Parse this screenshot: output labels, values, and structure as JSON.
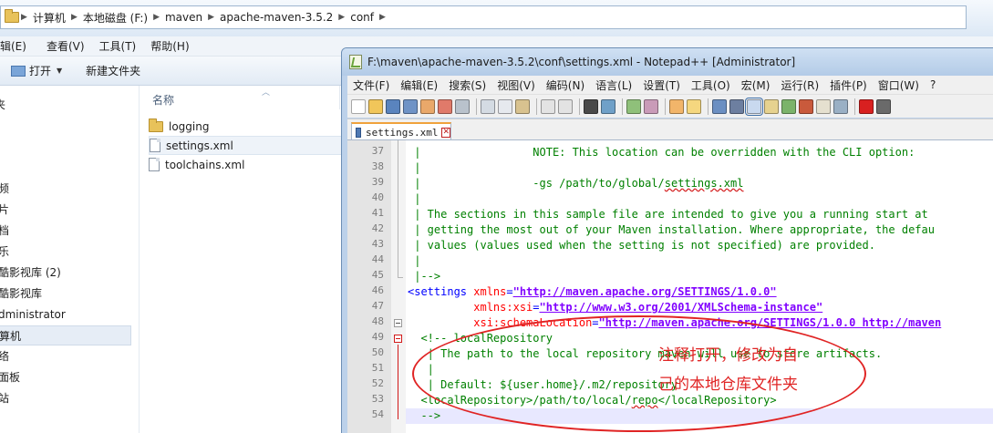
{
  "explorer": {
    "breadcrumb": [
      "计算机",
      "本地磁盘 (F:)",
      "maven",
      "apache-maven-3.5.2",
      "conf"
    ],
    "menu": [
      "编辑(E)",
      "查看(V)",
      "工具(T)",
      "帮助(H)"
    ],
    "toolbar": {
      "open": "打开",
      "new_folder": "新建文件夹"
    },
    "nav_items": [
      "夹",
      "频",
      "片",
      "档",
      "乐",
      "酷影视库 (2)",
      "酷影视库",
      "dministrator",
      "算机",
      "络",
      "面板",
      "站"
    ],
    "column_name": "名称",
    "files": [
      {
        "name": "logging",
        "type": "folder"
      },
      {
        "name": "settings.xml",
        "type": "file"
      },
      {
        "name": "toolchains.xml",
        "type": "file"
      }
    ]
  },
  "npp": {
    "title": "F:\\maven\\apache-maven-3.5.2\\conf\\settings.xml - Notepad++ [Administrator]",
    "menu": [
      "文件(F)",
      "编辑(E)",
      "搜索(S)",
      "视图(V)",
      "编码(N)",
      "语言(L)",
      "设置(T)",
      "工具(O)",
      "宏(M)",
      "运行(R)",
      "插件(P)",
      "窗口(W)",
      "?"
    ],
    "tab": "settings.xml",
    "line_numbers": [
      "37",
      "38",
      "39",
      "40",
      "41",
      "42",
      "43",
      "44",
      "45",
      "46",
      "47",
      "48",
      "49",
      "50",
      "51",
      "52",
      "53",
      "54"
    ],
    "code": {
      "l37": " |                 NOTE: This location can be overridden with the CLI option:",
      "l38": " |",
      "l39a": " |                 -gs /path/to/global/",
      "l39b": "settings.xml",
      "l40": " |",
      "l41": " | The sections in this sample file are intended to give you a running start at",
      "l42": " | getting the most out of your Maven installation. Where appropriate, the defau",
      "l43": " | values (values used when the setting is not specified) are provided.",
      "l44": " |",
      "l45": " |-->",
      "l46_tag": "<settings ",
      "l46_attr": "xmlns",
      "l46_eq": "=",
      "l46_val": "\"http://maven.apache.org/SETTINGS/1.0.0\"",
      "l47_indent": "          ",
      "l47_attr": "xmlns:xsi",
      "l47_eq": "=",
      "l47_val": "\"http://www.w3.org/2001/XMLSchema-instance\"",
      "l48_indent": "          ",
      "l48_attr": "xsi:schemaLocation",
      "l48_eq": "=",
      "l48_val": "\"http://maven.apache.org/SETTINGS/1.0.0 http://maven",
      "l49": "  <!-- localRepository",
      "l50": "   | The path to the local repository maven will use to store artifacts.",
      "l51": "   |",
      "l52": "   | Default: ${user.home}/.m2/repository",
      "l53_open": "  <localRepository>",
      "l53_txt": "/path/to/local/",
      "l53_sq": "repo",
      "l53_close": "</localRepository>",
      "l54": "  -->"
    }
  },
  "annotation": {
    "line1": "注释打开，修改为自",
    "line2": "己的本地仓库文件夹",
    "color": "#e02424"
  }
}
